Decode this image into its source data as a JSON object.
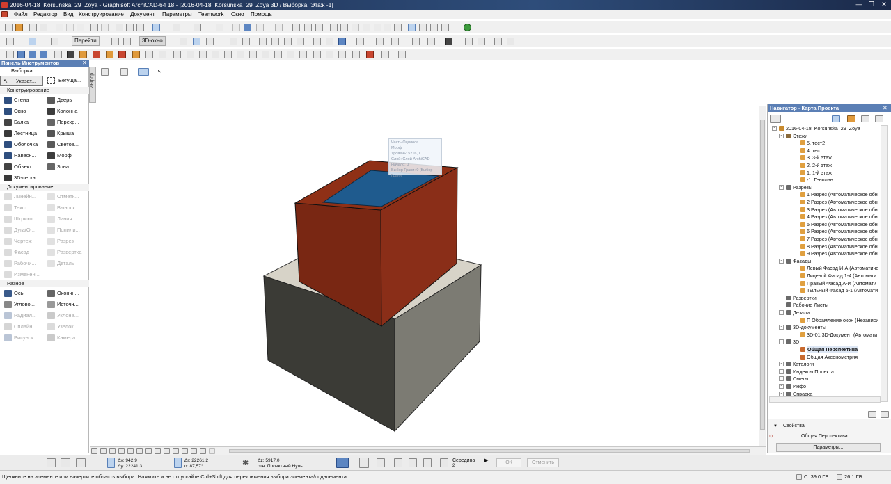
{
  "window": {
    "title": "2016-04-18_Korsunska_29_Zoya - Graphisoft ArchiCAD-64 18 - [2016-04-18_Korsunska_29_Zoya 3D / Выборка, Этаж -1]"
  },
  "menu": [
    "Файл",
    "Редактор",
    "Вид",
    "Конструирование",
    "Документ",
    "Параметры",
    "Teamwork",
    "Окно",
    "Помощь"
  ],
  "toolbar": {
    "goto_label": "Перейти",
    "view3d_label": "3D-окно"
  },
  "left_panel": {
    "title": "Панель Инструментов",
    "selection_label": "Выборка",
    "pointer_label": "Указат...",
    "marquee_label": "Бегуща...",
    "sections": {
      "design": "Конструирование",
      "document": "Документирование",
      "more": "Разное"
    },
    "design_tools": [
      "Стена",
      "Дверь",
      "Окно",
      "Колонна",
      "Балка",
      "Перекр...",
      "Лестница",
      "Крыша",
      "Оболочка",
      "Светов...",
      "Навесн...",
      "Морф",
      "Объект",
      "Зона",
      "3D-сетка"
    ],
    "document_tools": [
      "Линейн...",
      "Отметк...",
      "Текст",
      "Выноск...",
      "Штрихо...",
      "Линия",
      "Дуга/О...",
      "Полили...",
      "Чертеж",
      "Разрез",
      "Фасад",
      "Развертка",
      "Рабочи...",
      "Деталь",
      "Изменен..."
    ],
    "more_tools": [
      "Ось",
      "Окончн...",
      "Углово...",
      "Источн...",
      "Радиал...",
      "Уклона...",
      "Сплайн",
      "Узелок...",
      "Рисунок",
      "Камера"
    ]
  },
  "info_label": "Инфор...",
  "navigator": {
    "title": "Навигатор - Карта Проекта",
    "project": "2016-04-18_Korsunska_29_Zoya",
    "stories_label": "Этажи",
    "stories": [
      "5. тест2",
      "4. тест",
      "3. 3-й этаж",
      "2. 2-й этаж",
      "1. 1-й этаж",
      "-1. Генплан"
    ],
    "sections_label": "Разрезы",
    "sections": [
      "1 Разрез (Автоматическое обн",
      "2 Разрез (Автоматическое обн",
      "3 Разрез (Автоматическое обн",
      "4 Разрез (Автоматическое обн",
      "5 Разрез (Автоматическое обн",
      "6 Разрез (Автоматическое обн",
      "7 Разрез (Автоматическое обн",
      "8 Разрез (Автоматическое обн",
      "9 Разрез (Автоматическое обн"
    ],
    "elevations_label": "Фасады",
    "elevations": [
      "Левый Фасад И-А (Автоматиче",
      "Лицевой Фасад 1-4 (Автомати",
      "Правый Фасад А-И (Автомати",
      "Тыльный Фасад 5-1 (Автомати"
    ],
    "interior_label": "Развертки",
    "worksheets_label": "Рабочие Листы",
    "details_label": "Детали",
    "details": [
      "П Обрамление окон (Независи"
    ],
    "docs3d_label": "3D-документы",
    "docs3d": [
      "3D-01 3D-Документ (Автомати"
    ],
    "three_d_label": "3D",
    "three_d": [
      "Общая Перспектива",
      "Общая Аксонометрия"
    ],
    "others": [
      "Каталоги",
      "Индексы Проекта",
      "Сметы",
      "Инфо",
      "Справка"
    ]
  },
  "properties": {
    "label": "Свойства",
    "value": "Общая Перспектива",
    "params_button": "Параметры..."
  },
  "tooltip": {
    "lines": [
      "Часть Оцилоса",
      "Морф",
      "Уровень: 5216,0",
      "Слой: Слой ArchiCAD",
      "Начало: 0",
      "Выбор Грани: 0 [Выбор Грани"
    ]
  },
  "coords": {
    "dx": "Δx: 942,9",
    "dy": "Δy: 22241,3",
    "dr": "Δr: 22261,2",
    "angle": "α: 87,57°",
    "dz": "Δz: 5917,0",
    "ref": "отн. Проектный Нуль",
    "snap": "Середина",
    "snap_n": "2",
    "ok": "ОК",
    "cancel": "Отменить"
  },
  "status": {
    "message": "Щелкните на элементе или начертите область выбора. Нажмите и не отпускайте Ctrl+Shift для переключения выбора элемента/подэлемента.",
    "disk": "C: 39.0 ГБ",
    "memory": "26.1 ГБ"
  },
  "colors": {
    "title_bar": "#1b2a4a",
    "panel_header": "#5b7fb5",
    "building_top_color": "#8b2e17",
    "slab_color": "#d7d3c8",
    "glass_color": "#1f5b8e"
  }
}
